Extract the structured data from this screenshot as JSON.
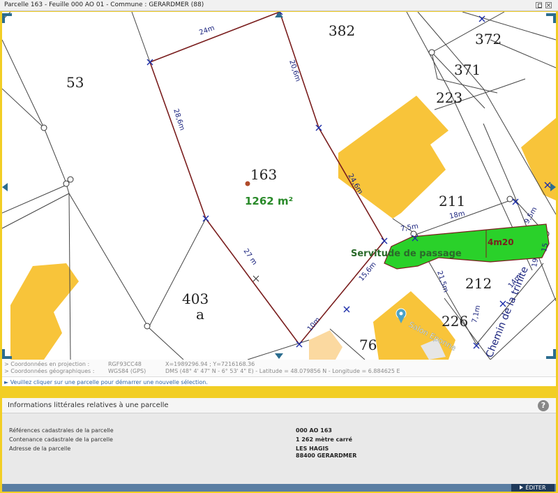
{
  "window": {
    "title": "Parcelle 163 - Feuille 000 AO 01 - Commune : GERARDMER (88)"
  },
  "map": {
    "selected_parcel": {
      "number": "163",
      "area": "1262 m²",
      "color": "#7a1e1e"
    },
    "parcel_numbers": [
      "53",
      "382",
      "372",
      "371",
      "223",
      "211",
      "212",
      "403",
      "a",
      "226",
      "76"
    ],
    "dimensions": [
      "24m",
      "20,6m",
      "28,6m",
      "24,6m",
      "27 m",
      "15,6m",
      "10m",
      "18m",
      "9,5m",
      "7,5m",
      "4m20",
      "21,5m",
      "14m",
      "7,1m",
      "19",
      "15"
    ],
    "easement_label": "Servitude de passage",
    "easement_color": "#2ad12a",
    "street_name": "Chemin de la trinite",
    "poi_label": "Salon Eponne",
    "building_color": "#f8c43a"
  },
  "coordinates": {
    "projection_label": "> Coordonnées en projection :",
    "projection_system": "RGF93CC48",
    "projection_value": "X=1989296.94 ; Y=7216168.36",
    "geo_label": "> Coordonnées géographiques :",
    "geo_system": "WGS84 (GPS)",
    "geo_value": "DMS (48° 4' 47\" N - 6° 53' 4\" E) - Latitude = 48.079856 N - Longitude = 6.884625 E"
  },
  "hint": "► Veuillez cliquer sur une parcelle pour démarrer une nouvelle sélection.",
  "info_panel": {
    "title": "Informations littérales relatives à une parcelle",
    "help_icon": "?",
    "rows": [
      {
        "label": "Références cadastrales de la parcelle",
        "value": "000 AO 163"
      },
      {
        "label": "Contenance cadastrale de la parcelle",
        "value": "1 262 mètre carré"
      },
      {
        "label": "Adresse de la parcelle",
        "value": "LES HAGIS",
        "value2": "88400 GERARDMER"
      }
    ],
    "edit_label": "ÉDITER"
  }
}
